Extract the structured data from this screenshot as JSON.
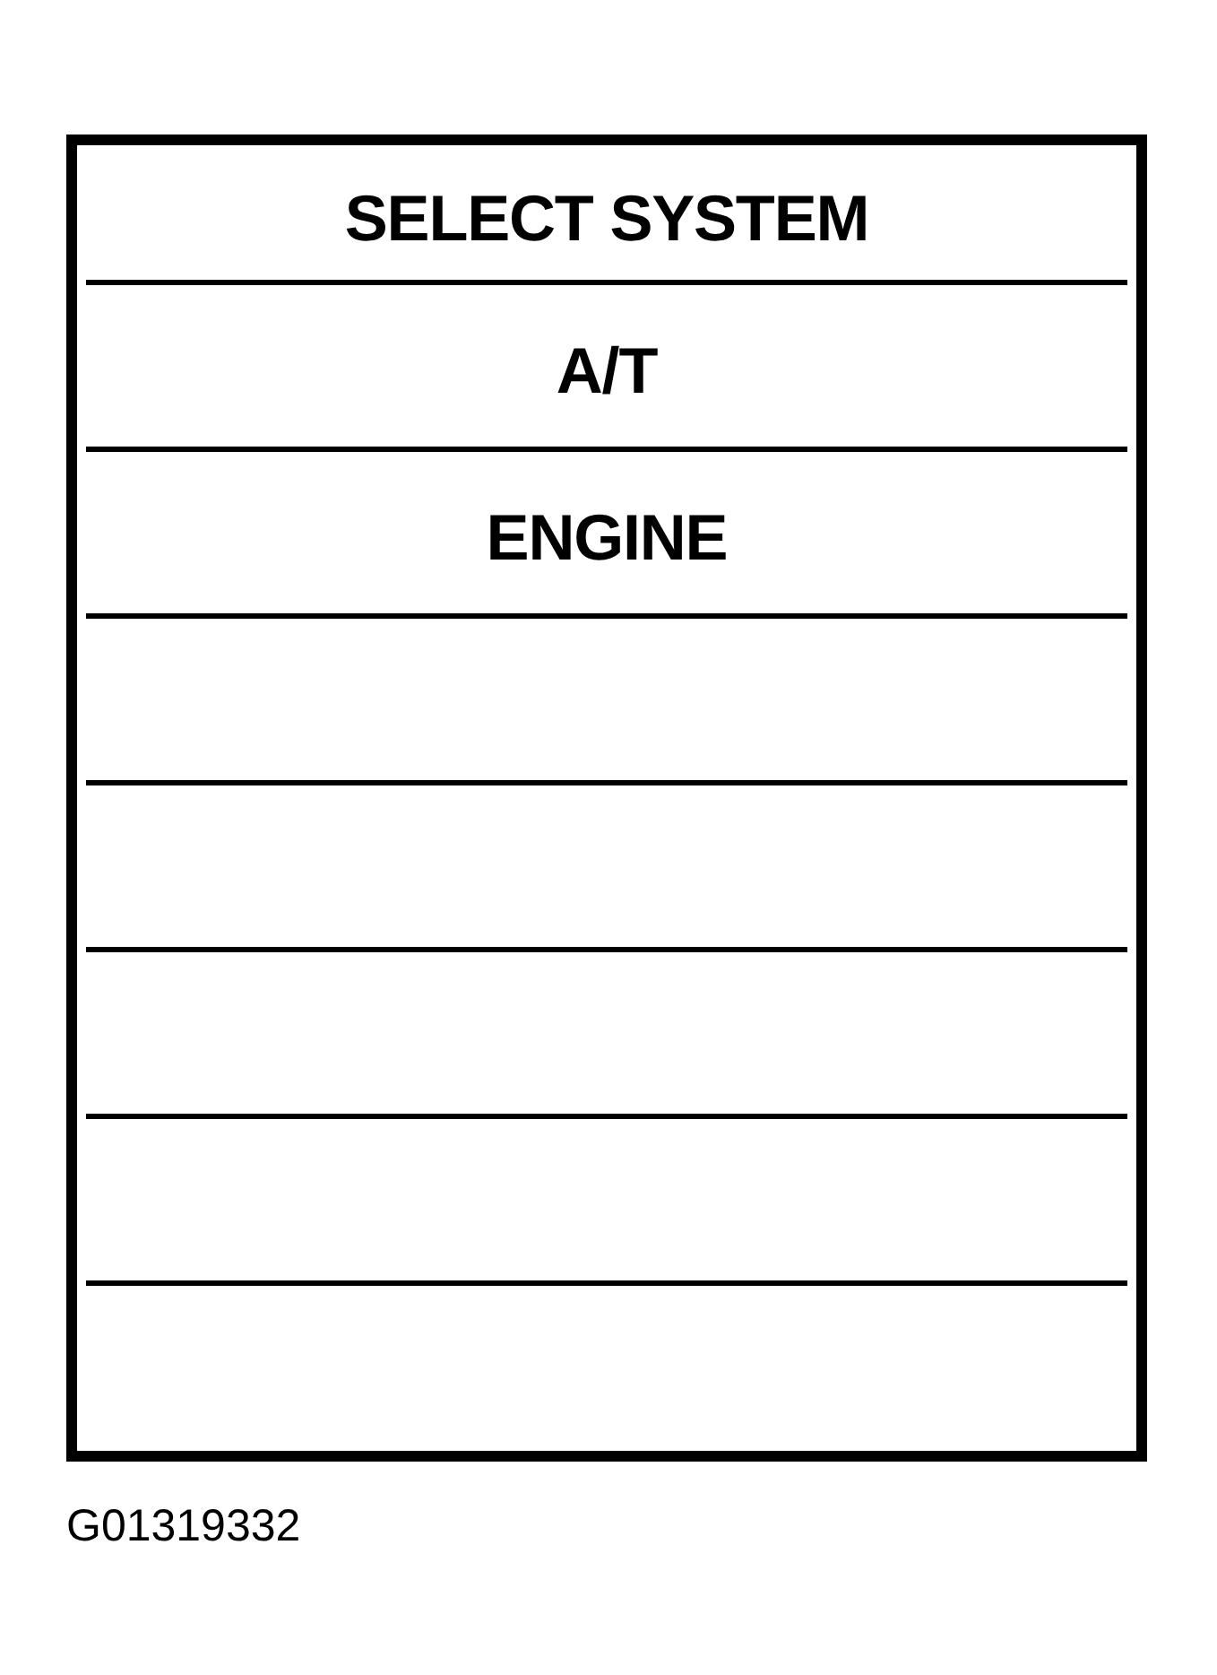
{
  "screen": {
    "title": "SELECT SYSTEM",
    "rows": [
      {
        "kind": "option",
        "label": "A/T"
      },
      {
        "kind": "option",
        "label": "ENGINE"
      },
      {
        "kind": "blank"
      },
      {
        "kind": "blank"
      },
      {
        "kind": "blank"
      },
      {
        "kind": "blank"
      },
      {
        "kind": "blank"
      }
    ]
  },
  "figure_id": "G01319332"
}
